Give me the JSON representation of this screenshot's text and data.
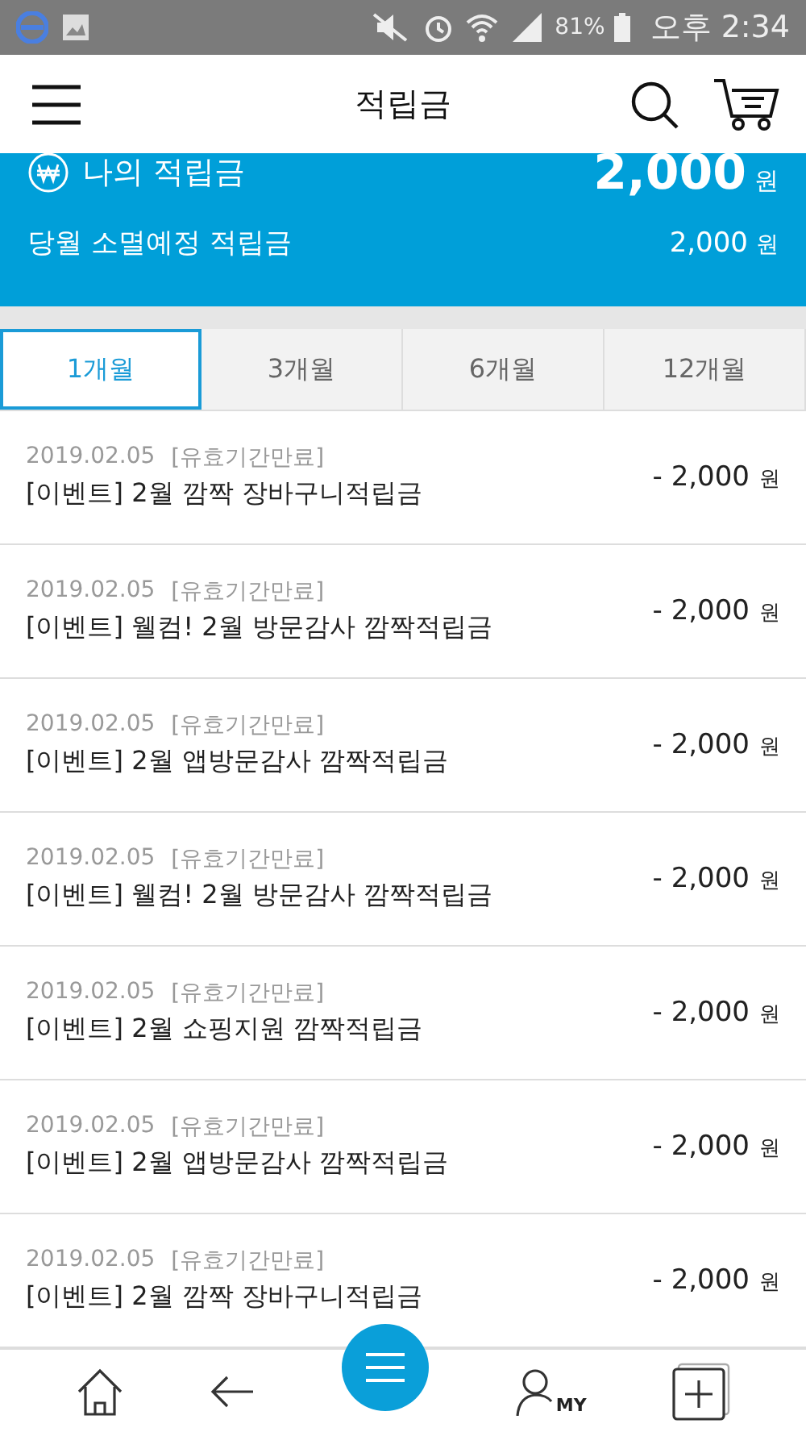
{
  "status_bar": {
    "battery": "81%",
    "time": "오후 2:34"
  },
  "header": {
    "title": "적립금"
  },
  "summary": {
    "label": "나의 적립금",
    "amount": "2,000",
    "unit": "원",
    "expiring_label": "당월 소멸예정 적립금",
    "expiring_amount": "2,000",
    "expiring_unit": "원"
  },
  "tabs": [
    {
      "label": "1개월",
      "selected": true
    },
    {
      "label": "3개월",
      "selected": false
    },
    {
      "label": "6개월",
      "selected": false
    },
    {
      "label": "12개월",
      "selected": false
    }
  ],
  "rows": [
    {
      "date": "2019.02.05",
      "status": "[유효기간만료]",
      "title": "[이벤트] 2월 깜짝 장바구니적립금",
      "amount": "- 2,000",
      "unit": "원"
    },
    {
      "date": "2019.02.05",
      "status": "[유효기간만료]",
      "title": "[이벤트] 웰컴! 2월 방문감사 깜짝적립금",
      "amount": "- 2,000",
      "unit": "원"
    },
    {
      "date": "2019.02.05",
      "status": "[유효기간만료]",
      "title": "[이벤트] 2월 앱방문감사 깜짝적립금",
      "amount": "- 2,000",
      "unit": "원"
    },
    {
      "date": "2019.02.05",
      "status": "[유효기간만료]",
      "title": "[이벤트] 웰컴! 2월 방문감사 깜짝적립금",
      "amount": "- 2,000",
      "unit": "원"
    },
    {
      "date": "2019.02.05",
      "status": "[유효기간만료]",
      "title": "[이벤트] 2월 쇼핑지원 깜짝적립금",
      "amount": "- 2,000",
      "unit": "원"
    },
    {
      "date": "2019.02.05",
      "status": "[유효기간만료]",
      "title": "[이벤트] 2월 앱방문감사 깜짝적립금",
      "amount": "- 2,000",
      "unit": "원"
    },
    {
      "date": "2019.02.05",
      "status": "[유효기간만료]",
      "title": "[이벤트] 2월 깜짝 장바구니적립금",
      "amount": "- 2,000",
      "unit": "원"
    }
  ],
  "bottom_nav": {
    "my_label": "MY"
  }
}
